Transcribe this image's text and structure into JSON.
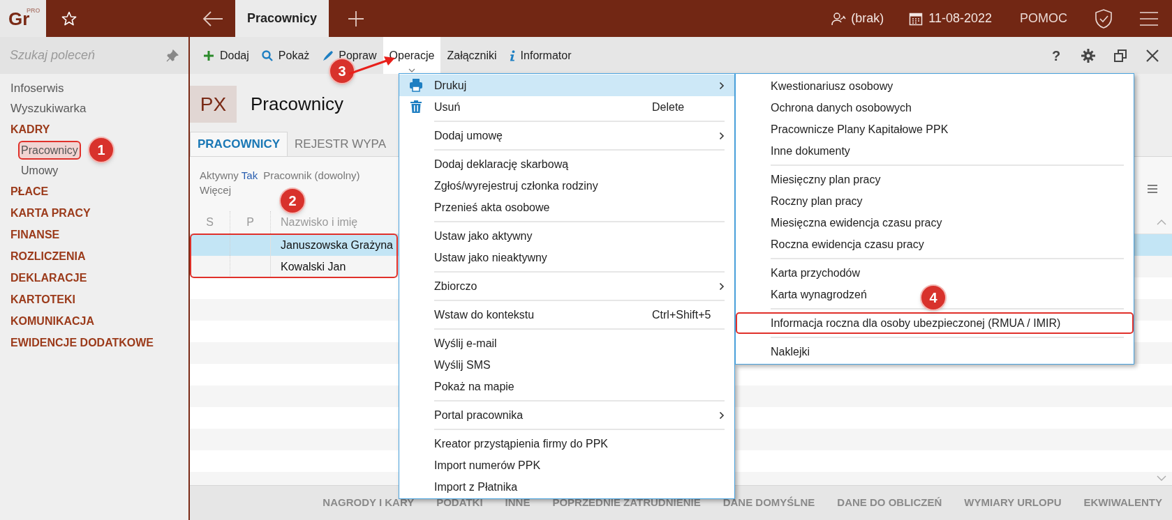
{
  "app": {
    "logo": "Gr",
    "logo_badge": "PRO"
  },
  "tabs": [
    {
      "label": "Pracownicy",
      "selected": true
    }
  ],
  "status": {
    "user": "(brak)",
    "date": "11-08-2022",
    "help": "POMOC"
  },
  "sidebar": {
    "search_placeholder": "Szukaj poleceń",
    "items": [
      {
        "label": "Infoserwis",
        "kind": "link",
        "selected": false
      },
      {
        "label": "Wyszukiwarka",
        "kind": "link",
        "selected": false
      },
      {
        "label": "KADRY",
        "kind": "section",
        "selected": false,
        "expanded": true,
        "children": [
          {
            "label": "Pracownicy",
            "selected": true,
            "callout": "1"
          },
          {
            "label": "Umowy",
            "selected": false
          }
        ]
      },
      {
        "label": "PŁACE",
        "kind": "section",
        "selected": false
      },
      {
        "label": "KARTA PRACY",
        "kind": "section",
        "selected": false
      },
      {
        "label": "FINANSE",
        "kind": "section",
        "selected": false
      },
      {
        "label": "ROZLICZENIA",
        "kind": "section",
        "selected": false
      },
      {
        "label": "DEKLARACJE",
        "kind": "section",
        "selected": false
      },
      {
        "label": "KARTOTEKI",
        "kind": "section",
        "selected": false
      },
      {
        "label": "KOMUNIKACJA",
        "kind": "section",
        "selected": false
      },
      {
        "label": "EWIDENCJE DODATKOWE",
        "kind": "section",
        "selected": false
      }
    ]
  },
  "toolbar": {
    "buttons": [
      {
        "label": "Dodaj",
        "selected": false
      },
      {
        "label": "Pokaż",
        "selected": false
      },
      {
        "label": "Popraw",
        "selected": false
      },
      {
        "label": "Operacje",
        "selected": true,
        "callout": "3"
      },
      {
        "label": "Załączniki",
        "selected": false
      },
      {
        "label": "Informator",
        "selected": false
      }
    ],
    "help": "?"
  },
  "header": {
    "badge": "PX",
    "title": "Pracownicy"
  },
  "view_tabs": [
    {
      "label": "PRACOWNICY",
      "selected": true
    },
    {
      "label": "REJESTR WYPA",
      "selected": false
    }
  ],
  "filters": [
    {
      "label": "Aktywny",
      "value": "Tak"
    },
    {
      "label": "Pracownik (dowolny)"
    }
  ],
  "filters_more": "Więcej",
  "table": {
    "columns": [
      "S",
      "P",
      "Nazwisko i imię"
    ],
    "callout": "2",
    "rows": [
      {
        "name": "Januszowska Grażyna",
        "selected": true
      },
      {
        "name": "Kowalski Jan",
        "selected": false
      }
    ]
  },
  "bottom_tabs": [
    "NAGRODY I KARY",
    "PODATKI",
    "INNE",
    "POPRZEDNIE ZATRUDNIENIE",
    "DANE DOMYŚLNE",
    "DANE DO OBLICZEŃ",
    "WYMIARY URLOPU",
    "EKWIWALENTY"
  ],
  "context_menu": {
    "groups": [
      [
        {
          "label": "Drukuj",
          "submenu": true,
          "selected": true
        },
        {
          "label": "Usuń",
          "shortcut": "Delete",
          "submenu": false,
          "selected": false
        }
      ],
      [
        {
          "label": "Dodaj umowę",
          "submenu": true,
          "selected": false
        }
      ],
      [
        {
          "label": "Dodaj deklarację skarbową",
          "submenu": false,
          "selected": false
        },
        {
          "label": "Zgłoś/wyrejestruj członka rodziny",
          "submenu": false,
          "selected": false
        },
        {
          "label": "Przenieś akta osobowe",
          "submenu": false,
          "selected": false
        }
      ],
      [
        {
          "label": "Ustaw jako aktywny",
          "submenu": false,
          "selected": false
        },
        {
          "label": "Ustaw jako nieaktywny",
          "submenu": false,
          "selected": false
        }
      ],
      [
        {
          "label": "Zbiorczo",
          "submenu": true,
          "selected": false
        }
      ],
      [
        {
          "label": "Wstaw do kontekstu",
          "shortcut": "Ctrl+Shift+5",
          "submenu": false,
          "selected": false
        }
      ],
      [
        {
          "label": "Wyślij e-mail",
          "submenu": false,
          "selected": false
        },
        {
          "label": "Wyślij SMS",
          "submenu": false,
          "selected": false
        },
        {
          "label": "Pokaż na mapie",
          "submenu": false,
          "selected": false
        }
      ],
      [
        {
          "label": "Portal pracownika",
          "submenu": true,
          "selected": false
        }
      ],
      [
        {
          "label": "Kreator przystąpienia firmy do PPK",
          "submenu": false,
          "selected": false
        },
        {
          "label": "Import numerów PPK",
          "submenu": false,
          "selected": false
        },
        {
          "label": "Import z Płatnika",
          "submenu": false,
          "selected": false
        }
      ]
    ]
  },
  "submenu": {
    "groups": [
      [
        {
          "label": "Kwestionariusz osobowy",
          "selected": false
        },
        {
          "label": "Ochrona danych osobowych",
          "selected": false
        },
        {
          "label": "Pracownicze Plany Kapitałowe PPK",
          "selected": false
        },
        {
          "label": "Inne dokumenty",
          "selected": false
        }
      ],
      [
        {
          "label": "Miesięczny plan pracy",
          "selected": false
        },
        {
          "label": "Roczny plan pracy",
          "selected": false
        },
        {
          "label": "Miesięczna ewidencja czasu pracy",
          "selected": false
        },
        {
          "label": "Roczna ewidencja czasu pracy",
          "selected": false
        }
      ],
      [
        {
          "label": "Karta przychodów",
          "selected": false
        },
        {
          "label": "Karta wynagrodzeń",
          "selected": false
        }
      ],
      [
        {
          "label": "Informacja roczna dla osoby ubezpieczonej (RMUA / IMIR)",
          "selected": false,
          "callout": "4"
        }
      ],
      [
        {
          "label": "Naklejki",
          "selected": false
        }
      ]
    ]
  }
}
